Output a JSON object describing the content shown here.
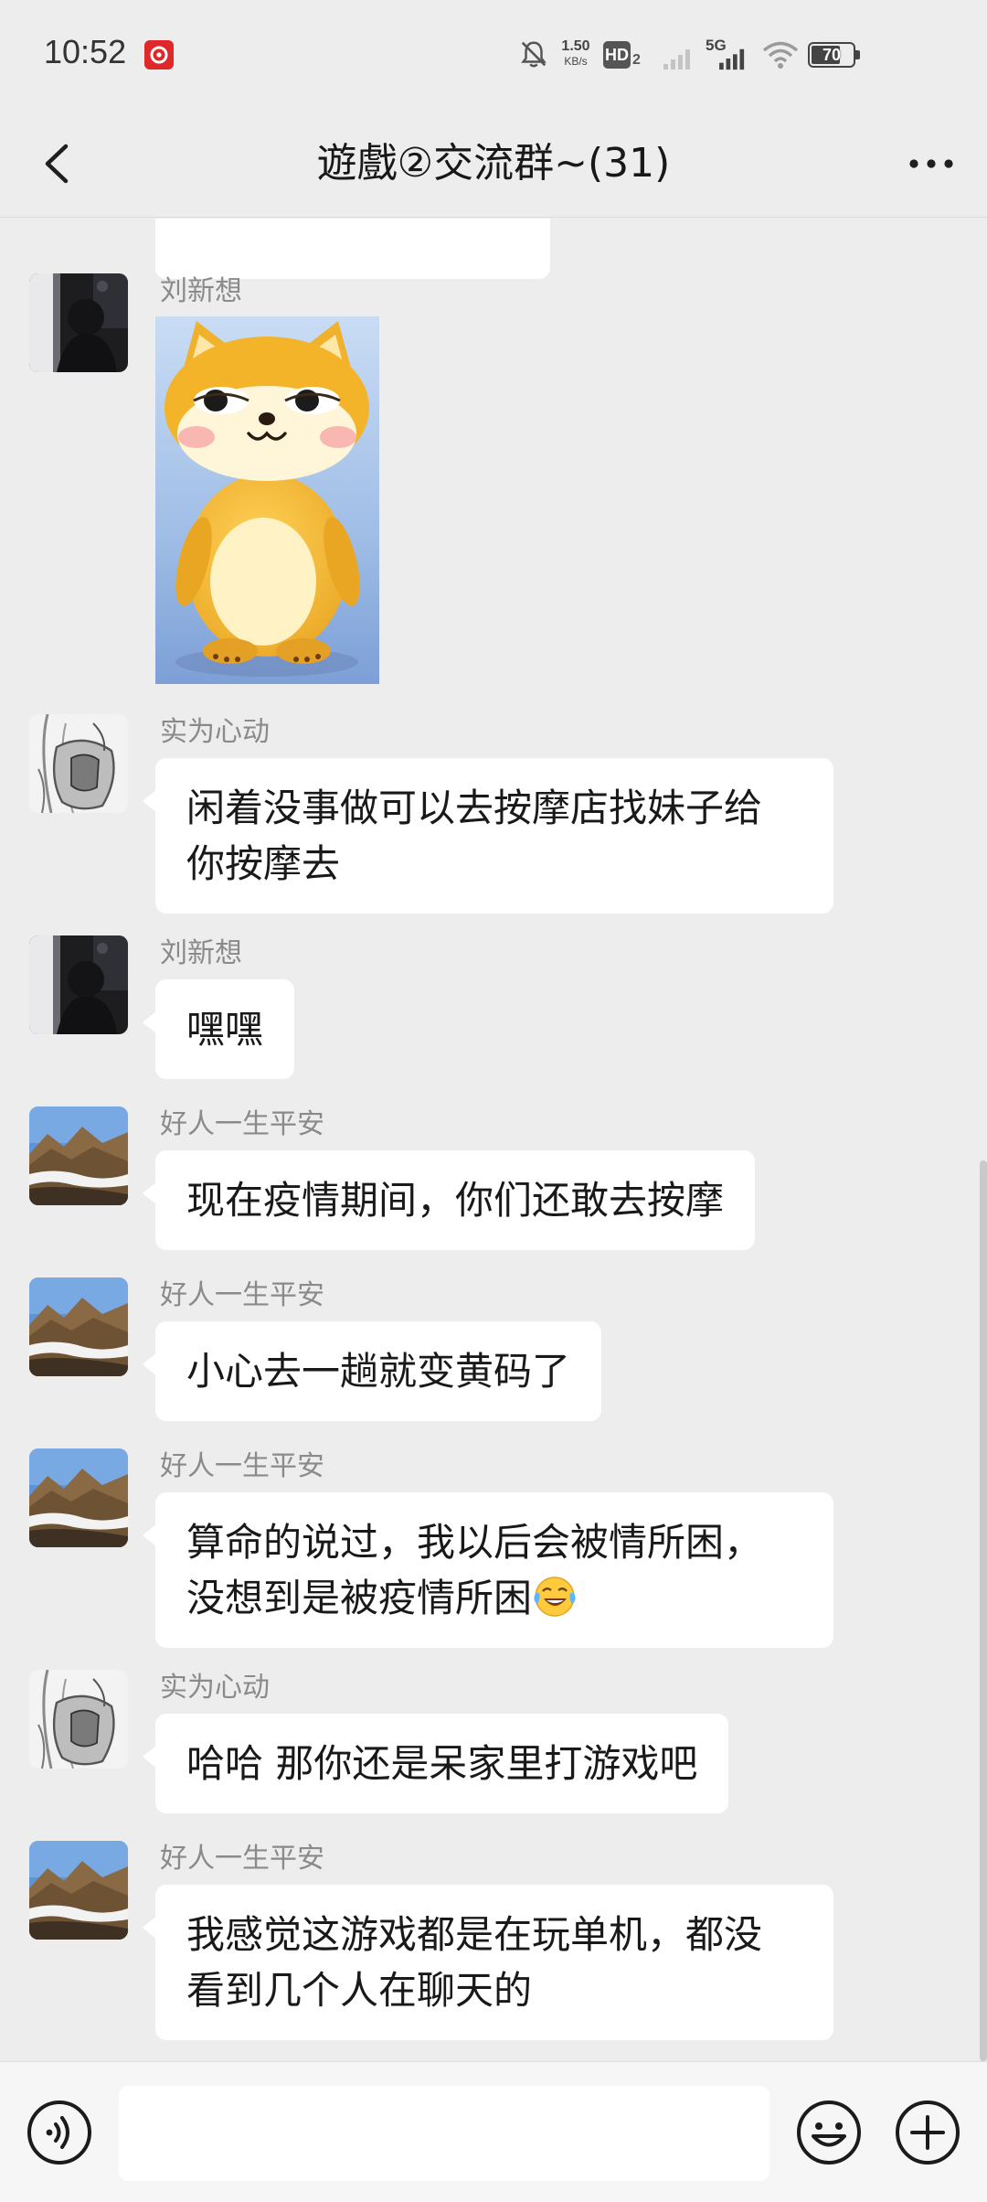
{
  "status_bar": {
    "time": "10:52",
    "net_speed_value": "1.50",
    "net_speed_unit": "KB/s",
    "hd_label": "HD",
    "hd_sub": "2",
    "network": "5G",
    "battery": "70",
    "icons": [
      "netease-music-icon",
      "mute-bell-icon",
      "hd-icon",
      "signal-icon",
      "wifi-icon",
      "battery-icon"
    ]
  },
  "header": {
    "title": "遊戲②交流群~(31)",
    "icons": [
      "back-icon",
      "more-icon"
    ]
  },
  "messages": [
    {
      "type": "image",
      "sender": "刘新想",
      "avatar": "dark-portrait-avatar"
    },
    {
      "type": "text",
      "sender": "实为心动",
      "avatar": "sketch-avatar",
      "lines": [
        "闲着没事做可以去按摩店找妹子给",
        "你按摩去"
      ]
    },
    {
      "type": "text",
      "sender": "刘新想",
      "avatar": "dark-portrait-avatar",
      "lines": [
        "嘿嘿"
      ]
    },
    {
      "type": "text",
      "sender": "好人一生平安",
      "avatar": "mountain-avatar",
      "lines": [
        "现在疫情期间，你们还敢去按摩"
      ]
    },
    {
      "type": "text",
      "sender": "好人一生平安",
      "avatar": "mountain-avatar",
      "lines": [
        "小心去一趟就变黄码了"
      ]
    },
    {
      "type": "text",
      "sender": "好人一生平安",
      "avatar": "mountain-avatar",
      "lines": [
        "算命的说过，我以后会被情所困，",
        "没想到是被疫情所困"
      ],
      "emoji": "laugh-crying-emoji"
    },
    {
      "type": "text",
      "sender": "实为心动",
      "avatar": "sketch-avatar",
      "lines": [
        "哈哈 那你还是呆家里打游戏吧"
      ]
    },
    {
      "type": "text",
      "sender": "好人一生平安",
      "avatar": "mountain-avatar",
      "lines": [
        "我感觉这游戏都是在玩单机，都没",
        "看到几个人在聊天的"
      ]
    }
  ],
  "input_bar": {
    "value": "",
    "icons": [
      "voice-icon",
      "emoji-face-icon",
      "plus-icon"
    ]
  }
}
